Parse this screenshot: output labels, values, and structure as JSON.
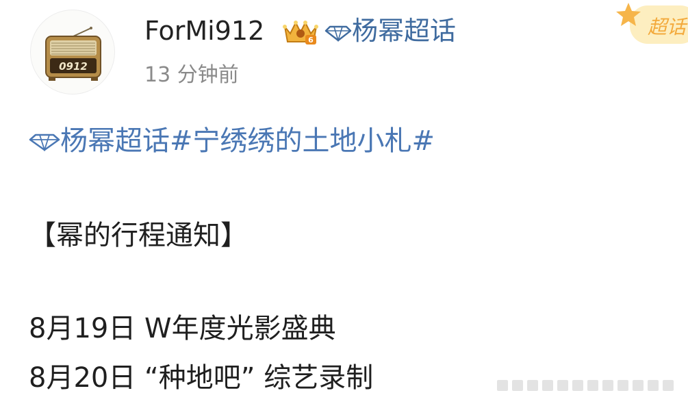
{
  "user": {
    "name": "ForMi912",
    "avatar_text": "0912",
    "level_badge": "6",
    "timestamp": "13 分钟前"
  },
  "topic": {
    "icon": "diamond-icon",
    "label": "杨幂超话"
  },
  "super_topic_badge": {
    "label": "超话"
  },
  "post": {
    "tag_line": "杨幂超话#宁绣绣的土地小札#",
    "title": "【幂的行程通知】",
    "schedule": [
      "8月19日 W年度光影盛典",
      "8月20日 “种地吧” 综艺录制"
    ]
  },
  "colors": {
    "link": "#4a77b4",
    "topic": "#3f6b9f",
    "timestamp": "#8a8a8a",
    "badge_bg": "#fdeec0",
    "badge_text": "#f3a93b"
  }
}
